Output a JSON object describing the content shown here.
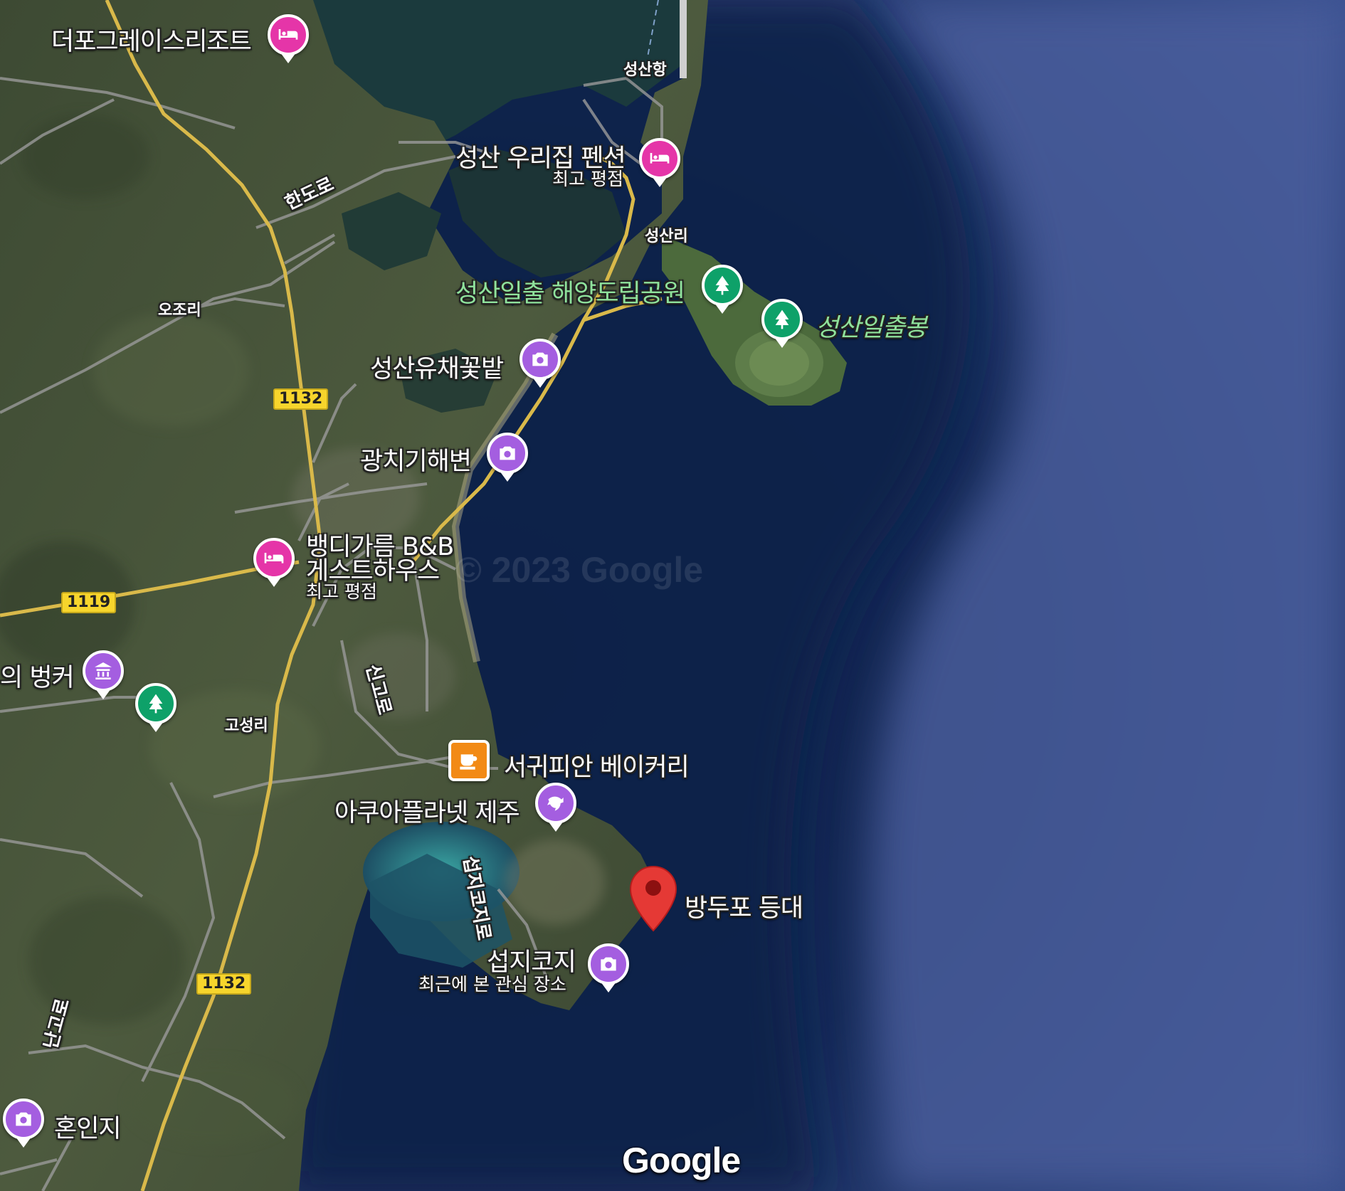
{
  "map_type": "satellite",
  "colors": {
    "hotel_pin": "#e535a8",
    "photo_pin": "#a45ee0",
    "park_pin": "#0ea169",
    "cafe_pin": "#f28a15",
    "selected_marker": "#e53935",
    "park_label": "#8fe29c",
    "route_shield": "#f7d52c"
  },
  "places": {
    "theporgrace": {
      "name": "더포그레이스리조트",
      "icon": "bed-icon"
    },
    "seongsan_urijib": {
      "name": "성산 우리집 펜션",
      "note": "최고 평점",
      "icon": "bed-icon"
    },
    "seongsan_park": {
      "name": "성산일출 해양도립공원",
      "icon": "tree-icon"
    },
    "seongsan_ilchulbong": {
      "name": "성산일출봉",
      "icon": "tree-icon"
    },
    "canola_field": {
      "name": "성산유채꽃밭",
      "icon": "camera-icon"
    },
    "gwangchigi": {
      "name": "광치기해변",
      "icon": "camera-icon"
    },
    "bbangdi": {
      "name_line1": "뱅디가름 B&B",
      "name_line2": "게스트하우스",
      "note": "최고 평점",
      "icon": "bed-icon"
    },
    "bunker": {
      "name": "의 벙커",
      "icon": "museum-icon"
    },
    "unnamed_park": {
      "icon": "tree-icon"
    },
    "bakery": {
      "name": "서귀피안 베이커리",
      "icon": "coffee-cup-icon"
    },
    "aquaplanet": {
      "name": "아쿠아플라넷 제주",
      "icon": "dolphin-icon"
    },
    "lighthouse": {
      "name": "방두포 등대",
      "icon": "map-marker-icon"
    },
    "seopjikoji": {
      "name": "섭지코지",
      "note": "최근에 본 관심 장소",
      "icon": "camera-icon"
    },
    "honinji": {
      "name": "혼인지",
      "icon": "camera-icon"
    }
  },
  "localities": {
    "seongsanhang": "성산항",
    "seongsanri": "성산리",
    "ojori": "오조리",
    "goseongri": "고성리"
  },
  "road_names": {
    "hando": "한도로",
    "sinyang": "신고로",
    "seopji": "섭지코지로",
    "nango": "난고로"
  },
  "route_shields": {
    "r1132_top": "1132",
    "r1119": "1119",
    "r1132_bottom": "1132"
  },
  "watermark": "© 2023 Google",
  "logo": "Google"
}
